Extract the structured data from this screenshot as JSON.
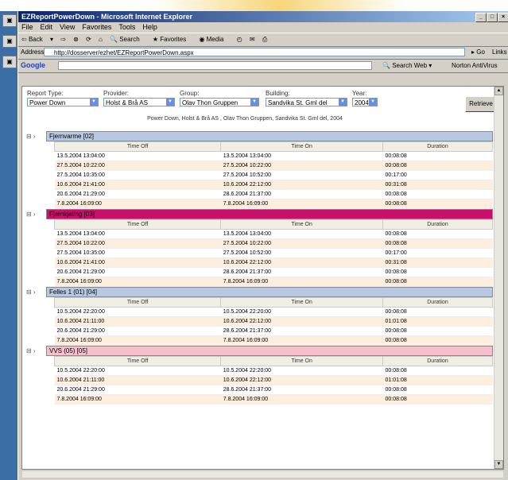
{
  "window": {
    "title": "EZReportPowerDown - Microsoft Internet Explorer"
  },
  "menu": [
    "File",
    "Edit",
    "View",
    "Favorites",
    "Tools",
    "Help"
  ],
  "toolbar": {
    "back": "Back",
    "search": "Search",
    "favorites": "Favorites",
    "media": "Media"
  },
  "address": {
    "label": "Address",
    "url": "http://dosserver/ezhet/EZReportPowerDown.aspx",
    "go": "Go",
    "links": "Links"
  },
  "google": {
    "logo": "Google",
    "search": "Search Web",
    "news": "Norton AntiVirus"
  },
  "filters": {
    "report_type": {
      "label": "Report Type:",
      "value": "Power Down"
    },
    "provider": {
      "label": "Provider:",
      "value": "Holst & Brå AS"
    },
    "group": {
      "label": "Group:",
      "value": "Olav Thon Gruppen"
    },
    "building": {
      "label": "Building:",
      "value": "Sandvika St. Gml del"
    },
    "year": {
      "label": "Year:",
      "value": "2004"
    },
    "retrieve": "Retrieve",
    "summary": "Power Down, Holst & Brå AS , Olav Thon Gruppen, Sandvika St. Gml del, 2004"
  },
  "columns": [
    "Time Off",
    "Time On",
    "Duration"
  ],
  "groups": [
    {
      "name": "Fjernvarme [02]",
      "color": "#b8c8e0",
      "rows": [
        [
          "13.5.2004 13:04:00",
          "13.5.2004 13:04:00",
          "00:08:08"
        ],
        [
          "27.5.2004 10:22:00",
          "27.5.2004 10:22:00",
          "00:08:08"
        ],
        [
          "27.5.2004 10:35:00",
          "27.5.2004 10:52:00",
          "00:17:00"
        ],
        [
          "10.6.2004 21:41:00",
          "10.6.2004 22:12:00",
          "00:31:08"
        ],
        [
          "20.6.2004 21:29:00",
          "28.6.2004 21:37:00",
          "00:08:08"
        ],
        [
          "7.8.2004 16:09:00",
          "7.8.2004 16:09:00",
          "00:08:08"
        ]
      ]
    },
    {
      "name": "Fjernkjøling [03]",
      "color": "#c8106a",
      "rows": [
        [
          "13.5.2004 13:04:00",
          "13.5.2004 13:04:00",
          "00:08:08"
        ],
        [
          "27.5.2004 10:22:00",
          "27.5.2004 10:22:00",
          "00:08:08"
        ],
        [
          "27.5.2004 10:35:00",
          "27.5.2004 10:52:00",
          "00:17:00"
        ],
        [
          "10.6.2004 21:41:00",
          "10.6.2004 22:12:00",
          "00:31:08"
        ],
        [
          "20.6.2004 21:29:00",
          "28.6.2004 21:37:00",
          "00:08:08"
        ],
        [
          "7.8.2004 16:09:00",
          "7.8.2004 16:09:00",
          "00:08:08"
        ]
      ]
    },
    {
      "name": "Felles 1 (01) [04]",
      "color": "#b8c8e0",
      "rows": [
        [
          "10.5.2004 22:20:00",
          "10.5.2004 22:20:00",
          "00:08:08"
        ],
        [
          "10.6.2004 21:11:00",
          "10.6.2004 22:12:00",
          "01:01:08"
        ],
        [
          "20.6.2004 21:29:00",
          "28.6.2004 21:37:00",
          "00:08:08"
        ],
        [
          "7.8.2004 16:09:00",
          "7.8.2004 16:09:00",
          "00:08:08"
        ]
      ]
    },
    {
      "name": "VVS (05) [05]",
      "color": "#f4c0cc",
      "rows": [
        [
          "10.5.2004 22:20:00",
          "10.5.2004 22:20:00",
          "00:08:08"
        ],
        [
          "10.6.2004 21:11:00",
          "10.6.2004 22:12:00",
          "01:01:08"
        ],
        [
          "20.6.2004 21:29:00",
          "28.6.2004 21:37:00",
          "00:08:08"
        ],
        [
          "7.8.2004 16:09:00",
          "7.8.2004 16:09:00",
          "00:08:08"
        ]
      ]
    }
  ]
}
